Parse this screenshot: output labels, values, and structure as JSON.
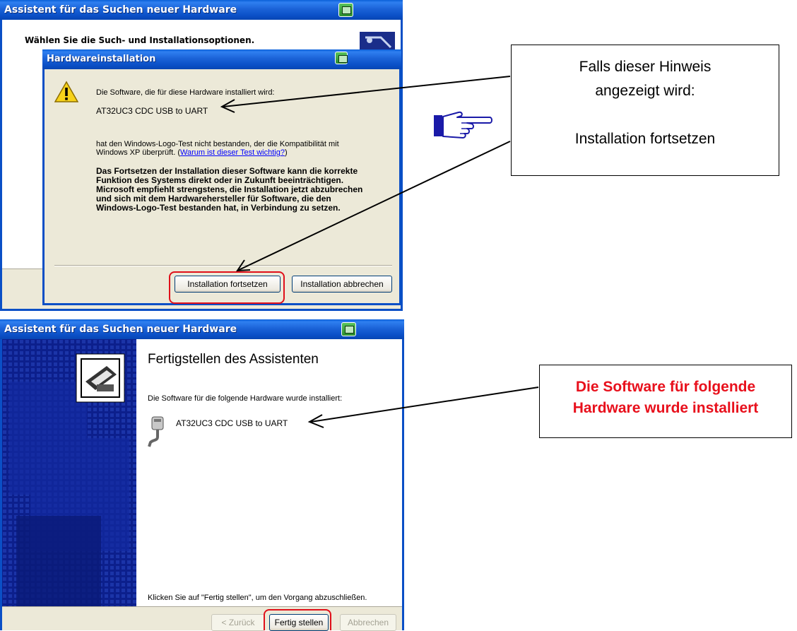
{
  "wizard1": {
    "title": "Assistent für das Suchen neuer Hardware",
    "subtitle": "Wählen Sie die Such- und Installationsoptionen."
  },
  "dialog": {
    "title": "Hardwareinstallation",
    "line1": "Die Software, die für diese Hardware installiert wird:",
    "device": "AT32UC3 CDC USB to UART",
    "para1_a": "hat den Windows-Logo-Test nicht bestanden, der die Kompatibilität mit",
    "para1_b": "Windows XP überprüft. (",
    "para1_link": "Warum ist dieser Test wichtig?",
    "para1_end": ")",
    "warning_lines": [
      "Das Fortsetzen der Installation dieser Software kann die korrekte",
      "Funktion des Systems direkt oder in Zukunft beeinträchtigen.",
      "Microsoft empfiehlt strengstens, die Installation jetzt abzubrechen",
      "und sich mit dem Hardwarehersteller für Software, die den",
      "Windows-Logo-Test bestanden hat, in Verbindung zu setzen."
    ],
    "continue_label": "Installation fortsetzen",
    "cancel_label": "Installation abbrechen"
  },
  "callout1": {
    "lines": [
      "Falls dieser Hinweis",
      "angezeigt wird:",
      "",
      "Installation fortsetzen"
    ]
  },
  "wizard2": {
    "title": "Assistent für das Suchen neuer Hardware",
    "heading": "Fertigstellen des Assistenten",
    "installed_text": "Die Software für die folgende Hardware wurde installiert:",
    "device": "AT32UC3 CDC USB to UART",
    "finish_hint": "Klicken Sie auf \"Fertig stellen\", um den Vorgang abzuschließen.",
    "back_label": "< Zurück",
    "finish_label": "Fertig stellen",
    "cancel_label": "Abbrechen"
  },
  "callout2": {
    "lines": [
      "Die Software für folgende",
      "Hardware wurde installiert"
    ],
    "color": "#e8101c"
  },
  "colors": {
    "titlebar": "#0a5fd8",
    "dialog_bg": "#ece9d8",
    "side_panel": "#0c1f8c",
    "link": "#0000ff",
    "highlight": "#e0101a"
  },
  "icons": [
    "warning-icon",
    "pointing-hand-icon",
    "help-icon",
    "hardware-wizard-icon",
    "serial-cable-icon",
    "search-icon"
  ]
}
